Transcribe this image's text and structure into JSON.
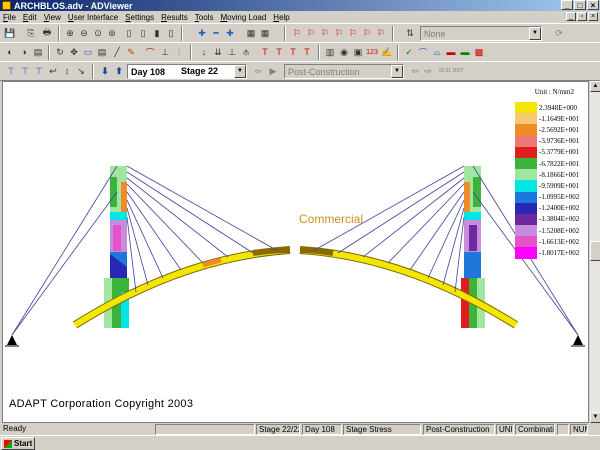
{
  "window": {
    "title": "ARCHBLOS.adv - ADViewer"
  },
  "menu": [
    "File",
    "Edit",
    "View",
    "User Interface",
    "Settings",
    "Results",
    "Tools",
    "Moving Load",
    "Help"
  ],
  "toolbar": {
    "combo_none": "None",
    "day_combo": "Day 108",
    "stage_label": "Stage 22",
    "construction_combo": "Post-Construction",
    "time_label": "15:31  2007"
  },
  "canvas": {
    "label": "Commercial",
    "copyright": "ADAPT Corporation Copyright 2003"
  },
  "legend": {
    "unit": "Unit : N/mm2",
    "entries": [
      {
        "label": "2.3948E+000",
        "color": "#f5e600"
      },
      {
        "label": "-1.1649E+001",
        "color": "#f5c878"
      },
      {
        "label": "-2.5692E+001",
        "color": "#f08c28"
      },
      {
        "label": "-3.9736E+001",
        "color": "#f07878"
      },
      {
        "label": "-5.3779E+001",
        "color": "#e01e1e"
      },
      {
        "label": "-6.7822E+001",
        "color": "#3cb43c"
      },
      {
        "label": "-8.1866E+001",
        "color": "#a0e6a0"
      },
      {
        "label": "-9.5909E+001",
        "color": "#00e6e6"
      },
      {
        "label": "-1.0995E+002",
        "color": "#1e78dc"
      },
      {
        "label": "-1.2400E+002",
        "color": "#2828b4"
      },
      {
        "label": "-1.3804E+002",
        "color": "#6e28a0"
      },
      {
        "label": "-1.5208E+002",
        "color": "#c88cdc"
      },
      {
        "label": "-1.6613E+002",
        "color": "#e650c8"
      },
      {
        "label": "-1.8017E+002",
        "color": "#ff00ff"
      }
    ]
  },
  "status": {
    "ready": "Ready",
    "stage": "Stage 22/22",
    "day": "Day 108",
    "stage_stress": "Stage Stress",
    "post": "Post-Construction",
    "unit": "UNIT",
    "combination": "Combination",
    "num": "NUM"
  },
  "taskbar": {
    "start": "Start"
  }
}
